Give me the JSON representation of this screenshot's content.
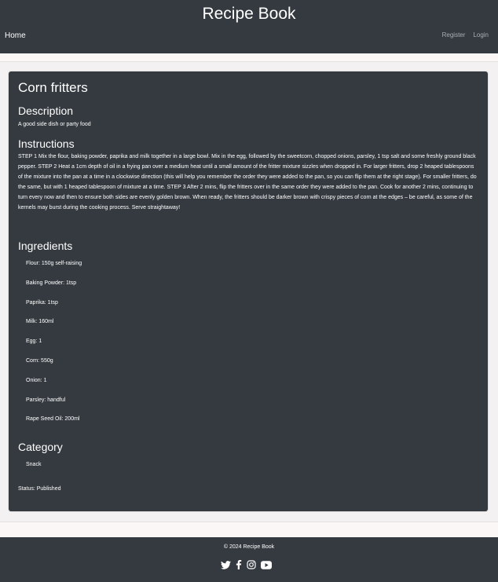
{
  "header": {
    "site_title": "Recipe Book",
    "nav_home": "Home",
    "nav_register": "Register",
    "nav_login": "Login"
  },
  "recipe": {
    "title": "Corn fritters",
    "description_heading": "Description",
    "description": "A good side dish or party food",
    "instructions_heading": "Instructions",
    "instructions": "STEP 1 Mix the flour, baking powder, paprika and milk together in a large bowl. Mix in the egg, followed by the sweetcorn, chopped onions, parsley, 1 tsp salt and some freshly ground black pepper. STEP 2 Heat a 1cm depth of oil in a frying pan over a medium heat until a small amount of the fritter mixture sizzles when dropped in. For larger fritters, drop 2 heaped tablespoons of the mixture into the pan at a time in a clockwise direction (this will help you remember the order they were added to the pan, so you can flip them at the right stage). For smaller fritters, do the same, but with 1 heaped tablespoon of mixture at a time. STEP 3 After 2 mins, flip the fritters over in the same order they were added to the pan. Cook for another 2 mins, continuing to turn every now and then to ensure both sides are evenly golden brown. When ready, the fritters should be darker brown with crispy pieces of corn at the edges – be careful, as some of the kernels may burst during the cooking process. Serve straightaway!",
    "ingredients_heading": "Ingredients",
    "ingredients": [
      "Flour: 150g self-raising",
      "Baking Powder: 1tsp",
      "Paprika: 1tsp",
      "Milk: 160ml",
      "Egg: 1",
      "Corn: 550g",
      "Onion: 1",
      "Parsley: handful",
      "Rape Seed Oil: 200ml"
    ],
    "category_heading": "Category",
    "category": "Snack",
    "status": "Status: Published"
  },
  "footer": {
    "copyright": "© 2024 Recipe Book",
    "social_icons": [
      "twitter-icon",
      "facebook-icon",
      "instagram-icon",
      "youtube-icon"
    ]
  },
  "colors": {
    "dark": "#343a40",
    "page_background": "#f3f1f1",
    "text": "#ffffff",
    "muted_link": "#a9aeb3"
  }
}
